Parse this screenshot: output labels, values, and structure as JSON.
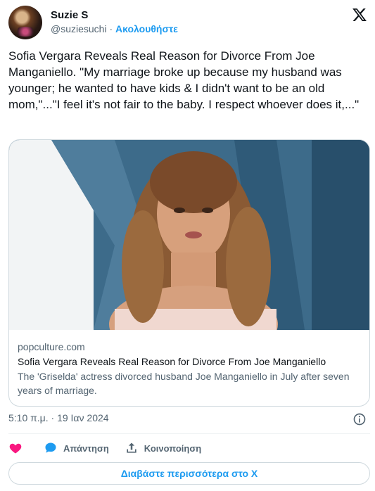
{
  "author": {
    "name": "Suzie S",
    "handle": "@suziesuchi",
    "separator": "·",
    "follow_label": "Ακολουθήστε",
    "avatar_icon": "avatar-photo"
  },
  "platform_icon": "x-logo-icon",
  "tweet": {
    "text": "Sofia Vergara Reveals Real Reason for Divorce From Joe Manganiello. \"My marriage broke up because my husband was younger; he wanted to have kids & I didn't want to be an old mom,\"...\"I feel it's not fair to the baby. I respect whoever does it,...\""
  },
  "card": {
    "domain": "popculture.com",
    "title": "Sofia Vergara Reveals Real Reason for Divorce From Joe Manganiello",
    "description": "The 'Griselda' actress divorced husband Joe Manganiello in July after seven years of marriage."
  },
  "timestamp": "5:10 π.μ. · 19 Ιαν 2024",
  "actions": {
    "like_icon": "heart-icon",
    "reply_label": "Απάντηση",
    "share_label": "Κοινοποίηση"
  },
  "read_more_label": "Διαβάστε περισσότερα στο X",
  "colors": {
    "accent": "#1d9bf0",
    "like": "#f91880",
    "text_primary": "#0f1419",
    "text_secondary": "#536471",
    "border": "#cfd9de"
  }
}
